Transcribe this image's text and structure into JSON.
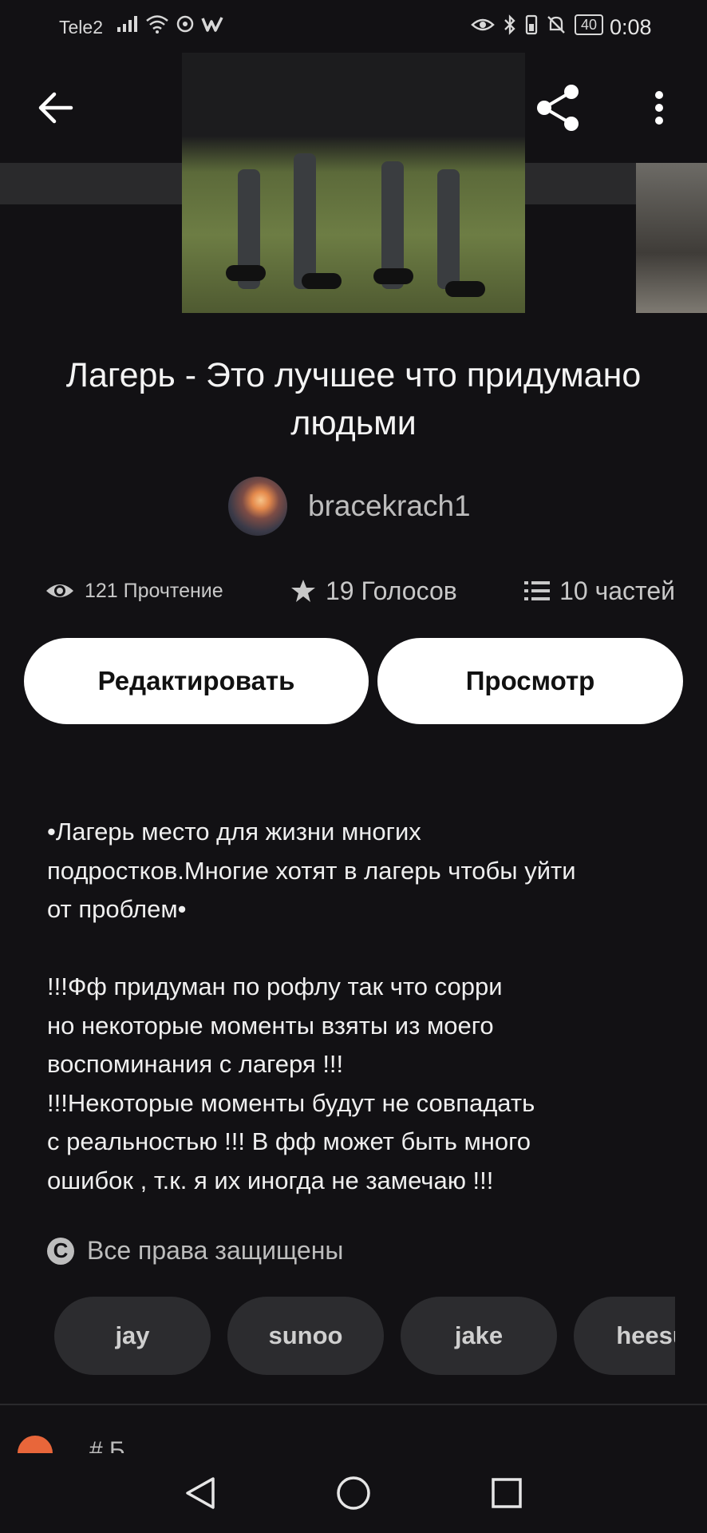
{
  "status_bar": {
    "carrier": "Tele2",
    "battery": "40",
    "time": "0:08"
  },
  "story": {
    "title": "Лагерь - Это лучшее что придумано людьми",
    "author": "bracekrach1",
    "reads": "121 Прочтение",
    "votes": "19 Голосов",
    "parts": "10 частей",
    "edit_label": "Редактировать",
    "view_label": "Просмотр",
    "description": "•Лагерь место для жизни многих\nподростков.Многие хотят в лагерь чтобы уйти\nот проблем•\n\n!!!Фф придуман по рофлу так что сорри\nно некоторые моменты взяты из моего\nвоспоминания с лагеря !!!\n!!!Некоторые моменты будут не совпадать\nс реальностью !!! В фф может быть много\nошибок , т.к. я их иногда не замечаю !!!",
    "copyright": "Все права защищены",
    "copyright_symbol": "C",
    "tags": [
      "jay",
      "sunoo",
      "jake",
      "heesu"
    ]
  },
  "peek": {
    "text": "# Б"
  },
  "icons": {
    "back": "arrow-left-icon",
    "share": "share-icon",
    "more": "more-vertical-icon",
    "reads": "eye-icon",
    "votes": "star-icon",
    "parts": "list-icon",
    "copyright": "copyright-icon"
  },
  "colors": {
    "background": "#121114",
    "button_bg": "#ffffff",
    "tag_bg": "#2c2c2f",
    "accent": "#e8663a"
  }
}
